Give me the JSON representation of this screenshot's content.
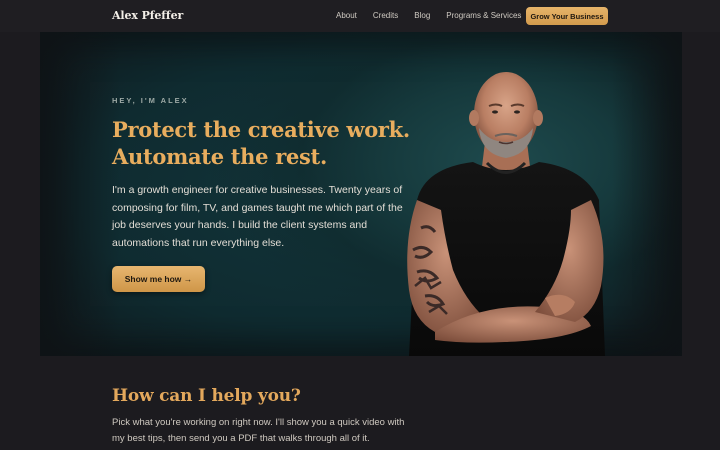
{
  "nav": {
    "brand": "Alex Pfeffer",
    "links": [
      "About",
      "Credits",
      "Blog",
      "Programs & Services"
    ],
    "cta": "Grow Your Business"
  },
  "hero": {
    "eyebrow": "HEY, I'M ALEX",
    "headline_line1": "Protect the creative work.",
    "headline_line2": "Automate the rest.",
    "intro": "I'm a growth engineer for creative businesses. Twenty years of composing for film, TV, and games taught me which part of the job deserves your hands. I build the client systems and automations that run everything else.",
    "cta": "Show me how →"
  },
  "help": {
    "title": "How can I help you?",
    "text": "Pick what you're working on right now. I'll show you a quick video with my best tips, then send you a PDF that walks through all of it."
  },
  "colors": {
    "background": "#1c1b1f",
    "accent": "#e3a85c",
    "hero_teal": "#163a3d"
  },
  "icons": {
    "portrait": "man-portrait-image"
  }
}
